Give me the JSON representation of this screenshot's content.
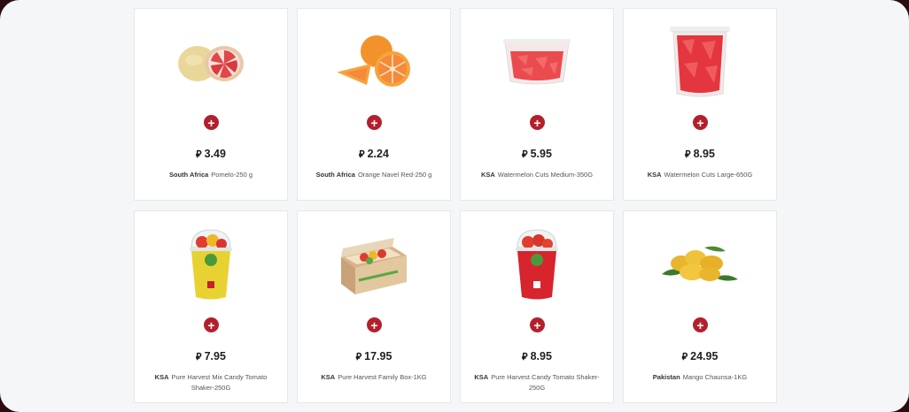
{
  "currency_symbol": "⃁",
  "colors": {
    "accent": "#b3202c",
    "card_border": "#e6e8eb",
    "page_bg": "#f5f6f8"
  },
  "add_button": {
    "icon": "plus-icon",
    "label": "+"
  },
  "products": [
    {
      "price": "3.49",
      "origin": "South Africa",
      "name": "Pomelo-250 g",
      "image": "pomelo"
    },
    {
      "price": "2.24",
      "origin": "South Africa",
      "name": "Orange Navel Red-250 g",
      "image": "orange"
    },
    {
      "price": "5.95",
      "origin": "KSA",
      "name": "Watermelon Cuts Medium-350G",
      "image": "watermelon-tub-medium"
    },
    {
      "price": "8.95",
      "origin": "KSA",
      "name": "Watermelon Cuts Large-650G",
      "image": "watermelon-tub-large"
    },
    {
      "price": "7.95",
      "origin": "KSA",
      "name": "Pure Harvest Mix Candy Tomato Shaker-250G",
      "image": "tomato-shaker-yellow"
    },
    {
      "price": "17.95",
      "origin": "KSA",
      "name": "Pure Harvest Family Box-1KG",
      "image": "tomato-family-box"
    },
    {
      "price": "8.95",
      "origin": "KSA",
      "name": "Pure Harvest Candy Tomato Shaker-250G",
      "image": "tomato-shaker-red"
    },
    {
      "price": "24.95",
      "origin": "Pakistan",
      "name": "Mango Chaunsa-1KG",
      "image": "mango"
    }
  ]
}
